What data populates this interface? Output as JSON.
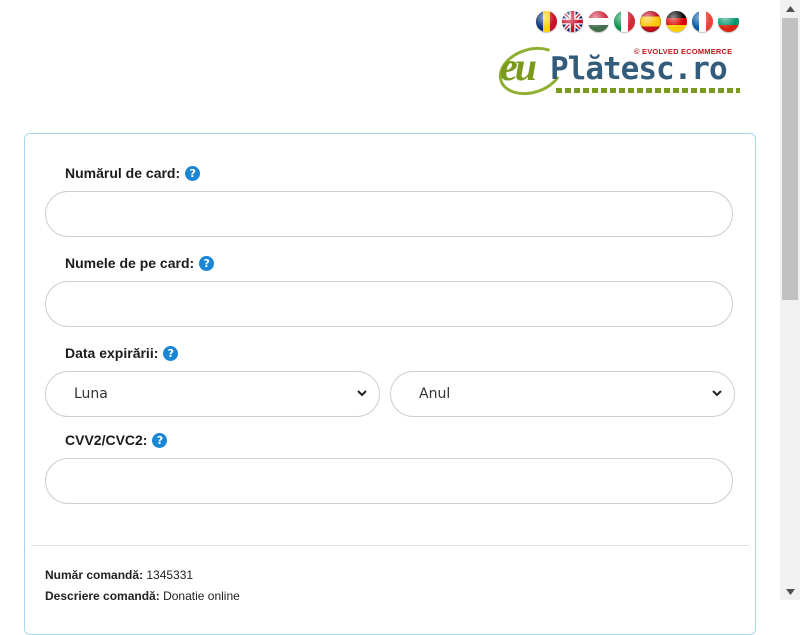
{
  "languages": [
    {
      "name": "ro",
      "colors": [
        "#002b7f",
        "#fcd116",
        "#ce1126"
      ],
      "orient": "v"
    },
    {
      "name": "en",
      "colors": [
        "#012169",
        "#ffffff",
        "#c8102e"
      ],
      "orient": "uk"
    },
    {
      "name": "hu",
      "colors": [
        "#cd2a3e",
        "#ffffff",
        "#436f4d"
      ],
      "orient": "h"
    },
    {
      "name": "it",
      "colors": [
        "#009246",
        "#ffffff",
        "#ce2b37"
      ],
      "orient": "v"
    },
    {
      "name": "es",
      "colors": [
        "#c60b1e",
        "#ffc400",
        "#c60b1e"
      ],
      "orient": "es"
    },
    {
      "name": "de",
      "colors": [
        "#000000",
        "#dd0000",
        "#ffce00"
      ],
      "orient": "h"
    },
    {
      "name": "fr",
      "colors": [
        "#0055a4",
        "#ffffff",
        "#ef4135"
      ],
      "orient": "v"
    },
    {
      "name": "bg",
      "colors": [
        "#ffffff",
        "#00966e",
        "#d62612"
      ],
      "orient": "h"
    }
  ],
  "logo": {
    "tagline": "© EVOLVED ECOMMERCE",
    "eu": "eu",
    "brand": "Plătesc.ro"
  },
  "form": {
    "card_number_label": "Numărul de card:",
    "card_name_label": "Numele de pe card:",
    "expiry_label": "Data expirării:",
    "month_placeholder": "Luna",
    "year_placeholder": "Anul",
    "cvv_label": "CVV2/CVC2:",
    "help_glyph": "?"
  },
  "order": {
    "number_label": "Număr comandă:",
    "number_value": " 1345331",
    "description_label": "Descriere comandă:",
    "description_value": " Donatie online"
  }
}
